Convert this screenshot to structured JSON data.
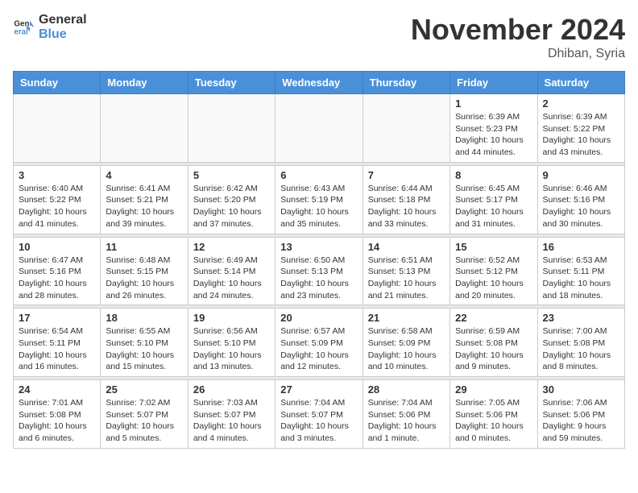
{
  "logo": {
    "line1": "General",
    "line2": "Blue"
  },
  "title": "November 2024",
  "location": "Dhiban, Syria",
  "days_of_week": [
    "Sunday",
    "Monday",
    "Tuesday",
    "Wednesday",
    "Thursday",
    "Friday",
    "Saturday"
  ],
  "weeks": [
    [
      {
        "day": "",
        "info": ""
      },
      {
        "day": "",
        "info": ""
      },
      {
        "day": "",
        "info": ""
      },
      {
        "day": "",
        "info": ""
      },
      {
        "day": "",
        "info": ""
      },
      {
        "day": "1",
        "info": "Sunrise: 6:39 AM\nSunset: 5:23 PM\nDaylight: 10 hours\nand 44 minutes."
      },
      {
        "day": "2",
        "info": "Sunrise: 6:39 AM\nSunset: 5:22 PM\nDaylight: 10 hours\nand 43 minutes."
      }
    ],
    [
      {
        "day": "3",
        "info": "Sunrise: 6:40 AM\nSunset: 5:22 PM\nDaylight: 10 hours\nand 41 minutes."
      },
      {
        "day": "4",
        "info": "Sunrise: 6:41 AM\nSunset: 5:21 PM\nDaylight: 10 hours\nand 39 minutes."
      },
      {
        "day": "5",
        "info": "Sunrise: 6:42 AM\nSunset: 5:20 PM\nDaylight: 10 hours\nand 37 minutes."
      },
      {
        "day": "6",
        "info": "Sunrise: 6:43 AM\nSunset: 5:19 PM\nDaylight: 10 hours\nand 35 minutes."
      },
      {
        "day": "7",
        "info": "Sunrise: 6:44 AM\nSunset: 5:18 PM\nDaylight: 10 hours\nand 33 minutes."
      },
      {
        "day": "8",
        "info": "Sunrise: 6:45 AM\nSunset: 5:17 PM\nDaylight: 10 hours\nand 31 minutes."
      },
      {
        "day": "9",
        "info": "Sunrise: 6:46 AM\nSunset: 5:16 PM\nDaylight: 10 hours\nand 30 minutes."
      }
    ],
    [
      {
        "day": "10",
        "info": "Sunrise: 6:47 AM\nSunset: 5:16 PM\nDaylight: 10 hours\nand 28 minutes."
      },
      {
        "day": "11",
        "info": "Sunrise: 6:48 AM\nSunset: 5:15 PM\nDaylight: 10 hours\nand 26 minutes."
      },
      {
        "day": "12",
        "info": "Sunrise: 6:49 AM\nSunset: 5:14 PM\nDaylight: 10 hours\nand 24 minutes."
      },
      {
        "day": "13",
        "info": "Sunrise: 6:50 AM\nSunset: 5:13 PM\nDaylight: 10 hours\nand 23 minutes."
      },
      {
        "day": "14",
        "info": "Sunrise: 6:51 AM\nSunset: 5:13 PM\nDaylight: 10 hours\nand 21 minutes."
      },
      {
        "day": "15",
        "info": "Sunrise: 6:52 AM\nSunset: 5:12 PM\nDaylight: 10 hours\nand 20 minutes."
      },
      {
        "day": "16",
        "info": "Sunrise: 6:53 AM\nSunset: 5:11 PM\nDaylight: 10 hours\nand 18 minutes."
      }
    ],
    [
      {
        "day": "17",
        "info": "Sunrise: 6:54 AM\nSunset: 5:11 PM\nDaylight: 10 hours\nand 16 minutes."
      },
      {
        "day": "18",
        "info": "Sunrise: 6:55 AM\nSunset: 5:10 PM\nDaylight: 10 hours\nand 15 minutes."
      },
      {
        "day": "19",
        "info": "Sunrise: 6:56 AM\nSunset: 5:10 PM\nDaylight: 10 hours\nand 13 minutes."
      },
      {
        "day": "20",
        "info": "Sunrise: 6:57 AM\nSunset: 5:09 PM\nDaylight: 10 hours\nand 12 minutes."
      },
      {
        "day": "21",
        "info": "Sunrise: 6:58 AM\nSunset: 5:09 PM\nDaylight: 10 hours\nand 10 minutes."
      },
      {
        "day": "22",
        "info": "Sunrise: 6:59 AM\nSunset: 5:08 PM\nDaylight: 10 hours\nand 9 minutes."
      },
      {
        "day": "23",
        "info": "Sunrise: 7:00 AM\nSunset: 5:08 PM\nDaylight: 10 hours\nand 8 minutes."
      }
    ],
    [
      {
        "day": "24",
        "info": "Sunrise: 7:01 AM\nSunset: 5:08 PM\nDaylight: 10 hours\nand 6 minutes."
      },
      {
        "day": "25",
        "info": "Sunrise: 7:02 AM\nSunset: 5:07 PM\nDaylight: 10 hours\nand 5 minutes."
      },
      {
        "day": "26",
        "info": "Sunrise: 7:03 AM\nSunset: 5:07 PM\nDaylight: 10 hours\nand 4 minutes."
      },
      {
        "day": "27",
        "info": "Sunrise: 7:04 AM\nSunset: 5:07 PM\nDaylight: 10 hours\nand 3 minutes."
      },
      {
        "day": "28",
        "info": "Sunrise: 7:04 AM\nSunset: 5:06 PM\nDaylight: 10 hours\nand 1 minute."
      },
      {
        "day": "29",
        "info": "Sunrise: 7:05 AM\nSunset: 5:06 PM\nDaylight: 10 hours\nand 0 minutes."
      },
      {
        "day": "30",
        "info": "Sunrise: 7:06 AM\nSunset: 5:06 PM\nDaylight: 9 hours\nand 59 minutes."
      }
    ]
  ]
}
